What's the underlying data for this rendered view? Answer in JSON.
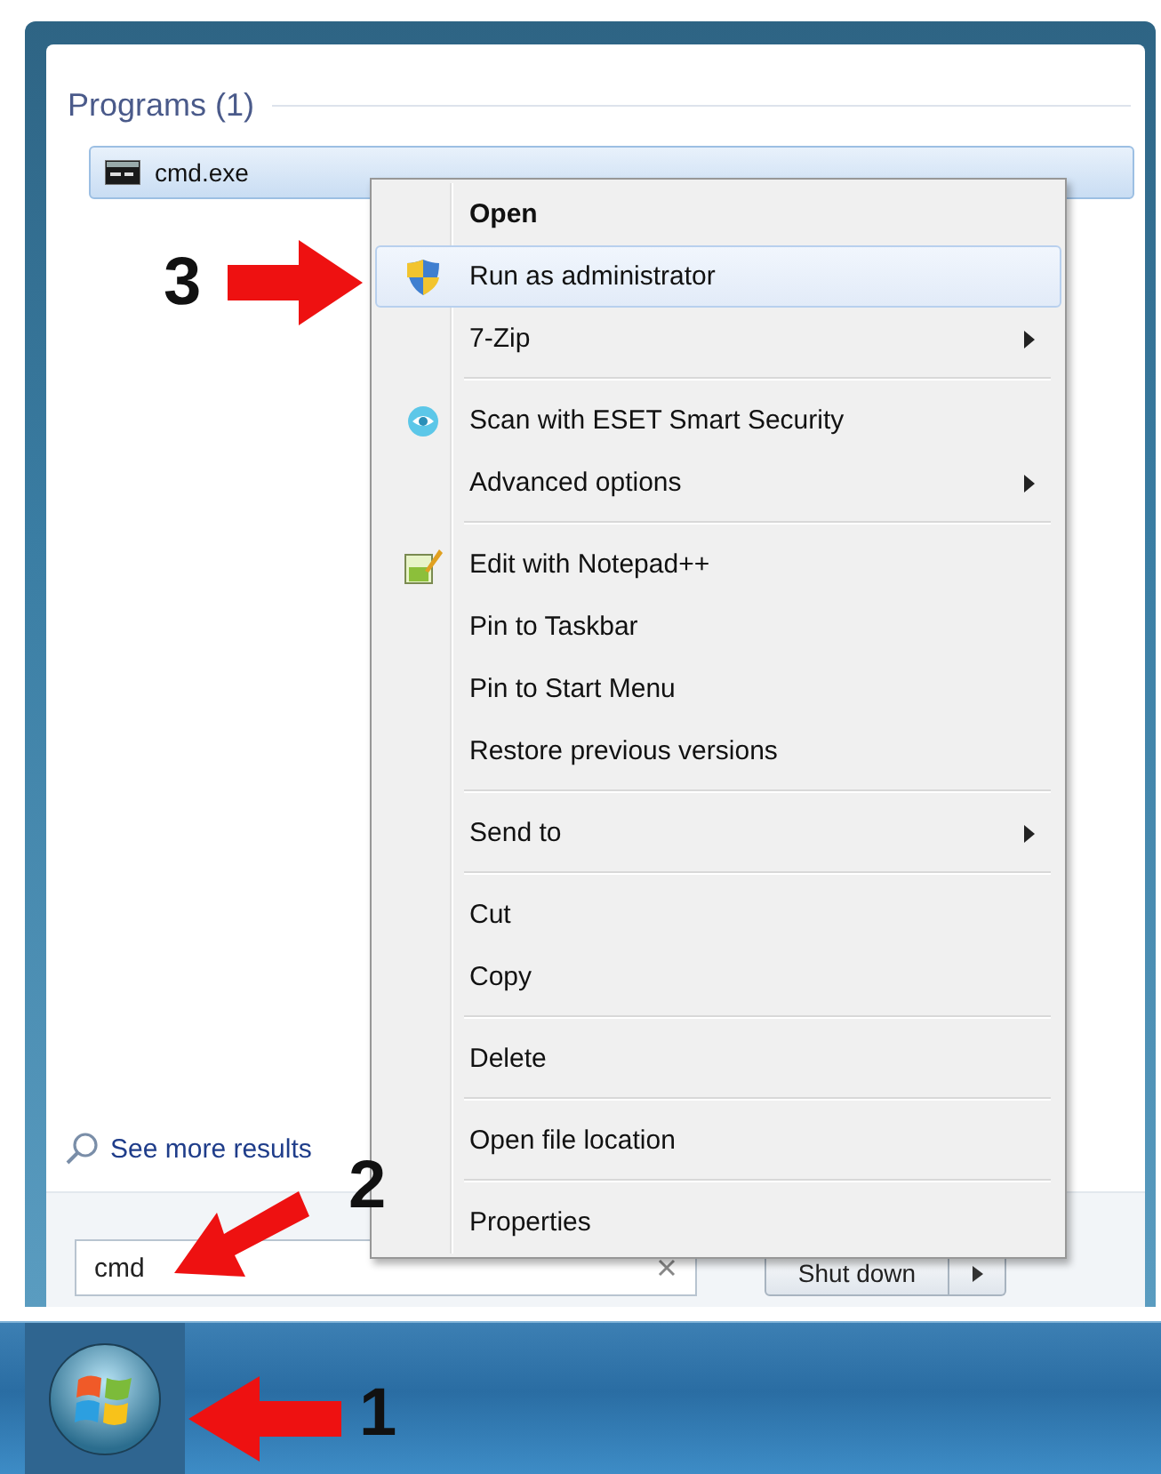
{
  "start_menu": {
    "section_title": "Programs (1)",
    "program": {
      "name": "cmd.exe",
      "selected": true
    },
    "see_more": "See more results",
    "search": {
      "value": "cmd"
    },
    "shutdown_button": "Shut down"
  },
  "context_menu": {
    "items": [
      {
        "kind": "plain",
        "label": "Open",
        "bold": true,
        "selected": false,
        "submenu": false
      },
      {
        "kind": "shield",
        "label": "Run as administrator",
        "bold": false,
        "selected": true,
        "submenu": false
      },
      {
        "kind": "plain",
        "label": "7-Zip",
        "bold": false,
        "selected": false,
        "submenu": true
      },
      {
        "kind": "separator"
      },
      {
        "kind": "scan",
        "label": "Scan with ESET Smart Security",
        "bold": false,
        "selected": false,
        "submenu": false
      },
      {
        "kind": "plain",
        "label": "Advanced options",
        "bold": false,
        "selected": false,
        "submenu": true
      },
      {
        "kind": "separator"
      },
      {
        "kind": "edit",
        "label": "Edit with Notepad++",
        "bold": false,
        "selected": false,
        "submenu": false
      },
      {
        "kind": "plain",
        "label": "Pin to Taskbar",
        "bold": false,
        "selected": false,
        "submenu": false
      },
      {
        "kind": "plain",
        "label": "Pin to Start Menu",
        "bold": false,
        "selected": false,
        "submenu": false
      },
      {
        "kind": "plain",
        "label": "Restore previous versions",
        "bold": false,
        "selected": false,
        "submenu": false
      },
      {
        "kind": "separator"
      },
      {
        "kind": "plain",
        "label": "Send to",
        "bold": false,
        "selected": false,
        "submenu": true
      },
      {
        "kind": "separator"
      },
      {
        "kind": "plain",
        "label": "Cut",
        "bold": false,
        "selected": false,
        "submenu": false
      },
      {
        "kind": "plain",
        "label": "Copy",
        "bold": false,
        "selected": false,
        "submenu": false
      },
      {
        "kind": "separator"
      },
      {
        "kind": "plain",
        "label": "Delete",
        "bold": false,
        "selected": false,
        "submenu": false
      },
      {
        "kind": "separator"
      },
      {
        "kind": "plain",
        "label": "Open file location",
        "bold": false,
        "selected": false,
        "submenu": false
      },
      {
        "kind": "separator"
      },
      {
        "kind": "plain",
        "label": "Properties",
        "bold": false,
        "selected": false,
        "submenu": false
      }
    ]
  },
  "callouts": [
    {
      "number": "3"
    },
    {
      "number": "2"
    },
    {
      "number": "1"
    }
  ]
}
